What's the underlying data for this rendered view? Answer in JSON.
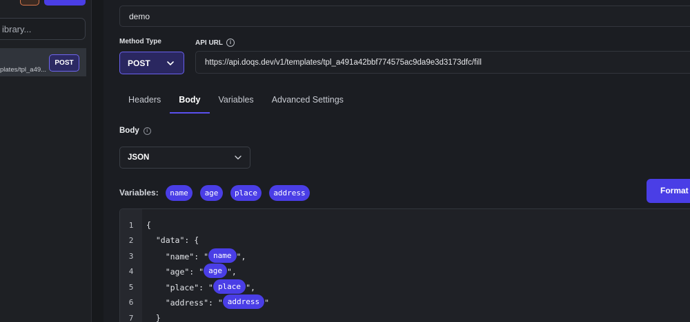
{
  "sidebar": {
    "search_placeholder": "ibrary...",
    "item_path": "plates/tpl_a49...",
    "item_method": "POST"
  },
  "form": {
    "name_value": "demo",
    "method_label": "Method Type",
    "method_value": "POST",
    "api_url_label": "API URL",
    "api_url_value": "https://api.doqs.dev/v1/templates/tpl_a491a42bbf774575ac9da9e3d3173dfc/fill"
  },
  "tabs": [
    {
      "label": "Headers",
      "active": false
    },
    {
      "label": "Body",
      "active": true
    },
    {
      "label": "Variables",
      "active": false
    },
    {
      "label": "Advanced Settings",
      "active": false
    }
  ],
  "body": {
    "label": "Body",
    "type_value": "JSON",
    "variables_label": "Variables:",
    "variables": [
      "name",
      "age",
      "place",
      "address"
    ],
    "format_label": "Format"
  },
  "editor": {
    "line_numbers": [
      "1",
      "2",
      "3",
      "4",
      "5",
      "6",
      "7"
    ],
    "lines": [
      {
        "pre": "{",
        "chip": "",
        "post": ""
      },
      {
        "pre": "  \"data\": {",
        "chip": "",
        "post": ""
      },
      {
        "pre": "    \"name\": \"",
        "chip": "name",
        "post": "\","
      },
      {
        "pre": "    \"age\": \"",
        "chip": "age",
        "post": "\","
      },
      {
        "pre": "    \"place\": \"",
        "chip": "place",
        "post": "\","
      },
      {
        "pre": "    \"address\": \"",
        "chip": "address",
        "post": "\""
      },
      {
        "pre": "  }",
        "chip": "",
        "post": ""
      }
    ]
  },
  "colors": {
    "accent": "#4a3ee6",
    "background": "#1b1d22"
  }
}
